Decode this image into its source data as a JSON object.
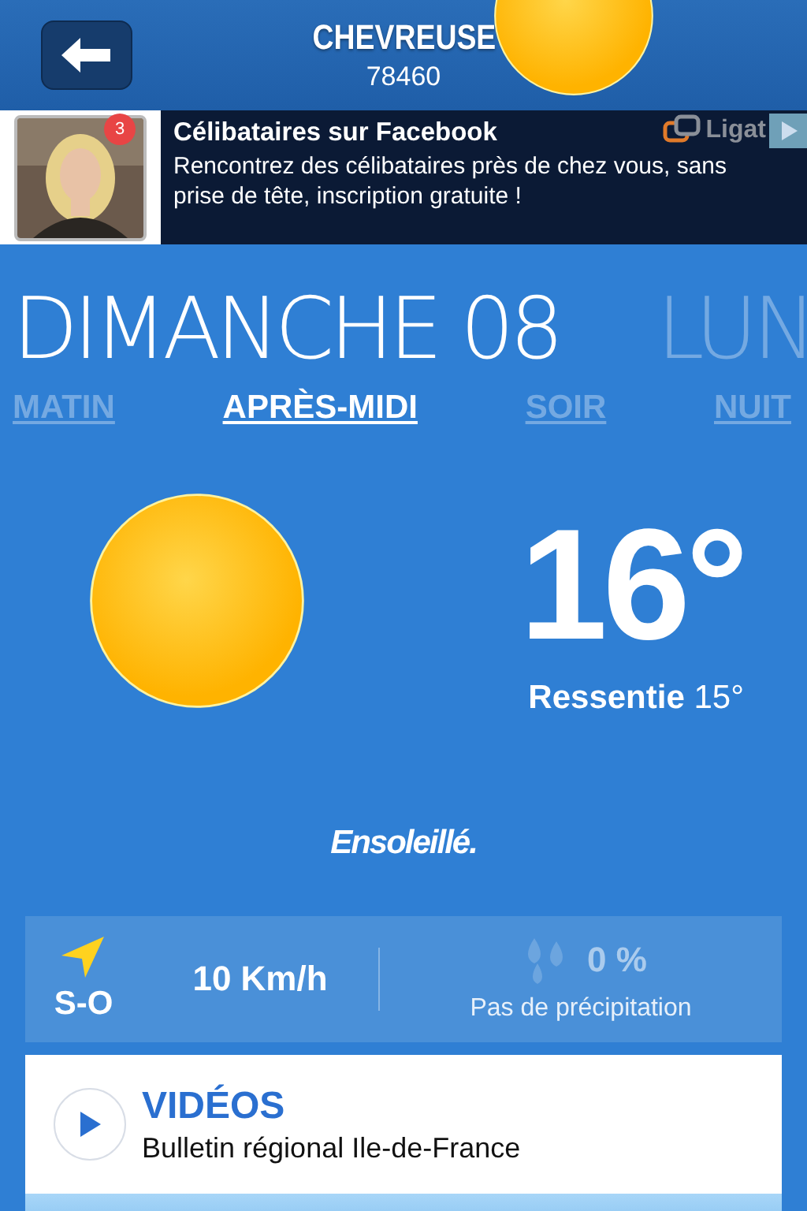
{
  "header": {
    "city": "CHEVREUSE",
    "postcode": "78460"
  },
  "ad": {
    "badge": "3",
    "title": "Célibataires sur Facebook",
    "text": "Rencontrez des célibataires près de chez vous, sans prise de tête, inscription gratuite !",
    "brand": "Ligat"
  },
  "days": [
    {
      "label": "DIMANCHE 08",
      "selected": true
    },
    {
      "label": "LUN",
      "selected": false
    }
  ],
  "tabs": [
    {
      "label": "MATIN",
      "selected": false
    },
    {
      "label": "APRÈS-MIDI",
      "selected": true
    },
    {
      "label": "SOIR",
      "selected": false
    },
    {
      "label": "NUIT",
      "selected": false
    }
  ],
  "forecast": {
    "temperature": "16°",
    "feels_label": "Ressentie",
    "feels_value": "15°",
    "condition": "Ensoleillé."
  },
  "wind": {
    "direction": "S-O",
    "speed": "10 Km/h"
  },
  "precipitation": {
    "value": "0 %",
    "label": "Pas de précipitation"
  },
  "videos": {
    "title": "VIDÉOS",
    "subtitle": "Bulletin régional Ile-de-France"
  }
}
